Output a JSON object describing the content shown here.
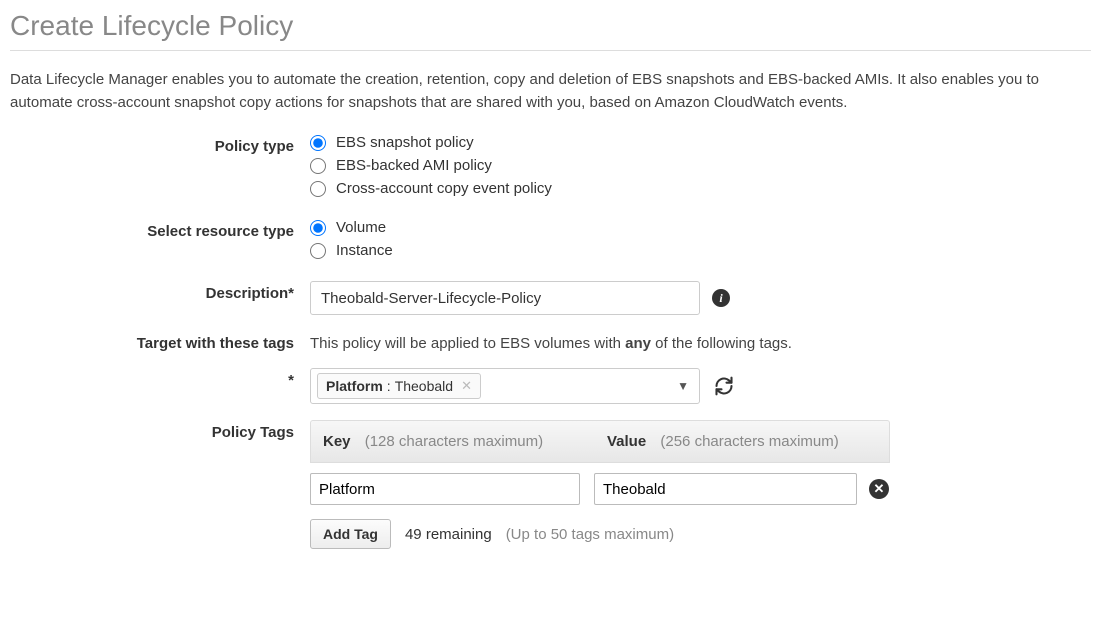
{
  "title": "Create Lifecycle Policy",
  "intro": "Data Lifecycle Manager enables you to automate the creation, retention, copy and deletion of EBS snapshots and EBS-backed AMIs. It also enables you to automate cross-account snapshot copy actions for snapshots that are shared with you, based on Amazon CloudWatch events.",
  "labels": {
    "policy_type": "Policy type",
    "resource_type": "Select resource type",
    "description": "Description*",
    "target_tags": "Target with these tags",
    "policy_tags": "Policy Tags",
    "tag_asterisk": "*"
  },
  "policy_type": {
    "options": [
      "EBS snapshot policy",
      "EBS-backed AMI policy",
      "Cross-account copy event policy"
    ],
    "selected": 0
  },
  "resource_type": {
    "options": [
      "Volume",
      "Instance"
    ],
    "selected": 0
  },
  "description_value": "Theobald-Server-Lifecycle-Policy",
  "target_help_pre": "This policy will be applied to EBS volumes with ",
  "target_help_bold": "any",
  "target_help_post": " of the following tags.",
  "target_tag": {
    "key": "Platform",
    "sep": " : ",
    "value": "Theobald"
  },
  "policy_tags_table": {
    "key_label": "Key",
    "key_meta": "(128 characters maximum)",
    "value_label": "Value",
    "value_meta": "(256 characters maximum)",
    "rows": [
      {
        "key": "Platform",
        "value": "Theobald"
      }
    ]
  },
  "add_tag": {
    "button": "Add Tag",
    "remaining": "49 remaining",
    "max": "(Up to 50 tags maximum)"
  }
}
